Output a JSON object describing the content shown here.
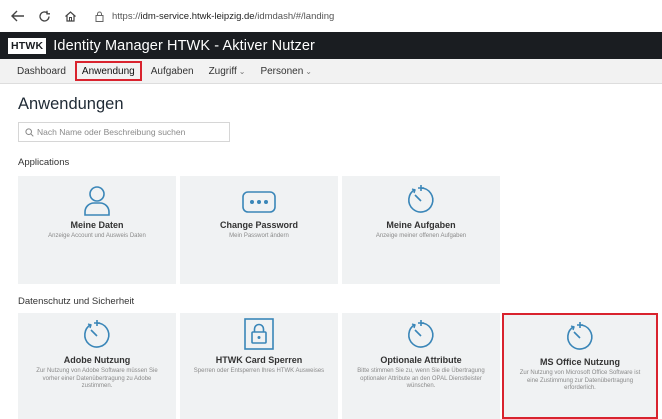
{
  "browser": {
    "url_prefix": "https://",
    "url_host": "idm-service.htwk-leipzig.de",
    "url_path": "/idmdash/#/landing"
  },
  "header": {
    "logo": "HTWK",
    "title": "Identity Manager HTWK - Aktiver Nutzer"
  },
  "nav": {
    "dashboard": "Dashboard",
    "anwendung": "Anwendung",
    "aufgaben": "Aufgaben",
    "zugriff": "Zugriff",
    "personen": "Personen"
  },
  "page": {
    "title": "Anwendungen",
    "search_placeholder": "Nach Name oder Beschreibung suchen"
  },
  "sections": {
    "applications": {
      "label": "Applications",
      "tiles": [
        {
          "title": "Meine Daten",
          "desc": "Anzeige Account und Ausweis Daten",
          "icon": "user-icon"
        },
        {
          "title": "Change Password",
          "desc": "Mein Passwort ändern",
          "icon": "password-icon"
        },
        {
          "title": "Meine Aufgaben",
          "desc": "Anzeige meiner offenen Aufgaben",
          "icon": "timer-icon"
        }
      ]
    },
    "datenschutz": {
      "label": "Datenschutz und Sicherheit",
      "tiles": [
        {
          "title": "Adobe Nutzung",
          "desc": "Zur Nutzung von Adobe Software müssen Sie vorher einer Datenübertragung zu Adobe zustimmen.",
          "icon": "timer-icon"
        },
        {
          "title": "HTWK Card Sperren",
          "desc": "Sperren oder Entsperren Ihres HTWK Ausweises",
          "icon": "card-lock-icon"
        },
        {
          "title": "Optionale Attribute",
          "desc": "Bitte stimmen Sie zu, wenn Sie die Übertragung optionaler Attribute an den OPAL Dienstleister wünschen.",
          "icon": "timer-icon"
        },
        {
          "title": "MS Office Nutzung",
          "desc": "Zur Nutzung von Microsoft Office Software ist eine Zustimmung zur Datenübertragung erforderlich.",
          "icon": "timer-icon"
        }
      ]
    }
  },
  "colors": {
    "accent_icon": "#3a86b8",
    "highlight": "#d9232e",
    "header_bg": "#1a1d21"
  }
}
